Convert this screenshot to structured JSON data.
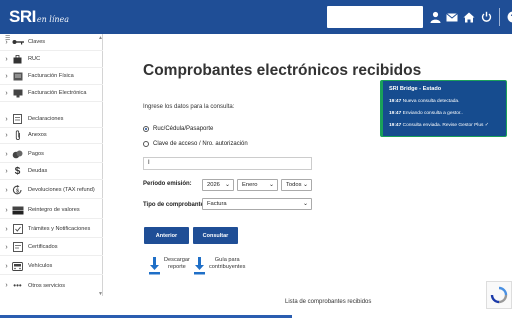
{
  "header": {
    "logo_main": "SRI",
    "logo_sub": "en línea",
    "icons": [
      "user-icon",
      "mail-icon",
      "home-icon",
      "power-icon",
      "help-icon"
    ]
  },
  "sidebar": {
    "items": [
      {
        "label": "Claves",
        "icon": "key-icon"
      },
      {
        "label": "RUC",
        "icon": "bag-icon"
      },
      {
        "label": "Facturación Física",
        "icon": "receipt-icon"
      },
      {
        "label": "Facturación Electrónica",
        "icon": "monitor-icon"
      },
      {
        "label": "Declaraciones",
        "icon": "document-icon"
      },
      {
        "label": "Anexos",
        "icon": "paperclip-icon"
      },
      {
        "label": "Pagos",
        "icon": "coins-icon"
      },
      {
        "label": "Deudas",
        "icon": "dollar-icon"
      },
      {
        "label": "Devoluciones (TAX refund)",
        "icon": "refund-icon"
      },
      {
        "label": "Reintegro de valores",
        "icon": "money-icon"
      },
      {
        "label": "Trámites y Notificaciones",
        "icon": "notification-icon"
      },
      {
        "label": "Certificados",
        "icon": "certificate-icon"
      },
      {
        "label": "Vehículos",
        "icon": "car-icon"
      },
      {
        "label": "Otros servicios",
        "icon": "dots-icon"
      }
    ]
  },
  "main": {
    "title": "Comprobantes electrónicos recibidos",
    "prompt": "Ingrese los datos para la consulta:",
    "radio_1": "Ruc/Cédula/Pasaporte",
    "radio_2": "Clave de acceso / Nro. autorización",
    "id_value": "I",
    "label_periodo": "Período emisión:",
    "year": "2026",
    "month": "Enero",
    "day": "Todos",
    "label_tipo": "Tipo de comprobante",
    "tipo": "Factura",
    "btn_anterior": "Anterior",
    "btn_consultar": "Consultar",
    "download_line1": "Descargar",
    "download_line2": "reporte",
    "guide_line1": "Guía para",
    "guide_line2": "contribuyentes",
    "list_title": "Lista de comprobantes recibidos"
  },
  "status_panel": {
    "title": "SRI Bridge - Estado",
    "lines": [
      {
        "time": "19:47",
        "text": "Nueva consulta detectada."
      },
      {
        "time": "19:47",
        "text": "Enviando consulta a gestor.."
      },
      {
        "time": "19:47",
        "text": "Consulta enviada. Revise Gestor Plus ✓"
      }
    ]
  },
  "colors": {
    "brand_blue": "#1f4e96",
    "panel_blue": "#164c8f",
    "panel_border_green": "#1aa05a"
  }
}
